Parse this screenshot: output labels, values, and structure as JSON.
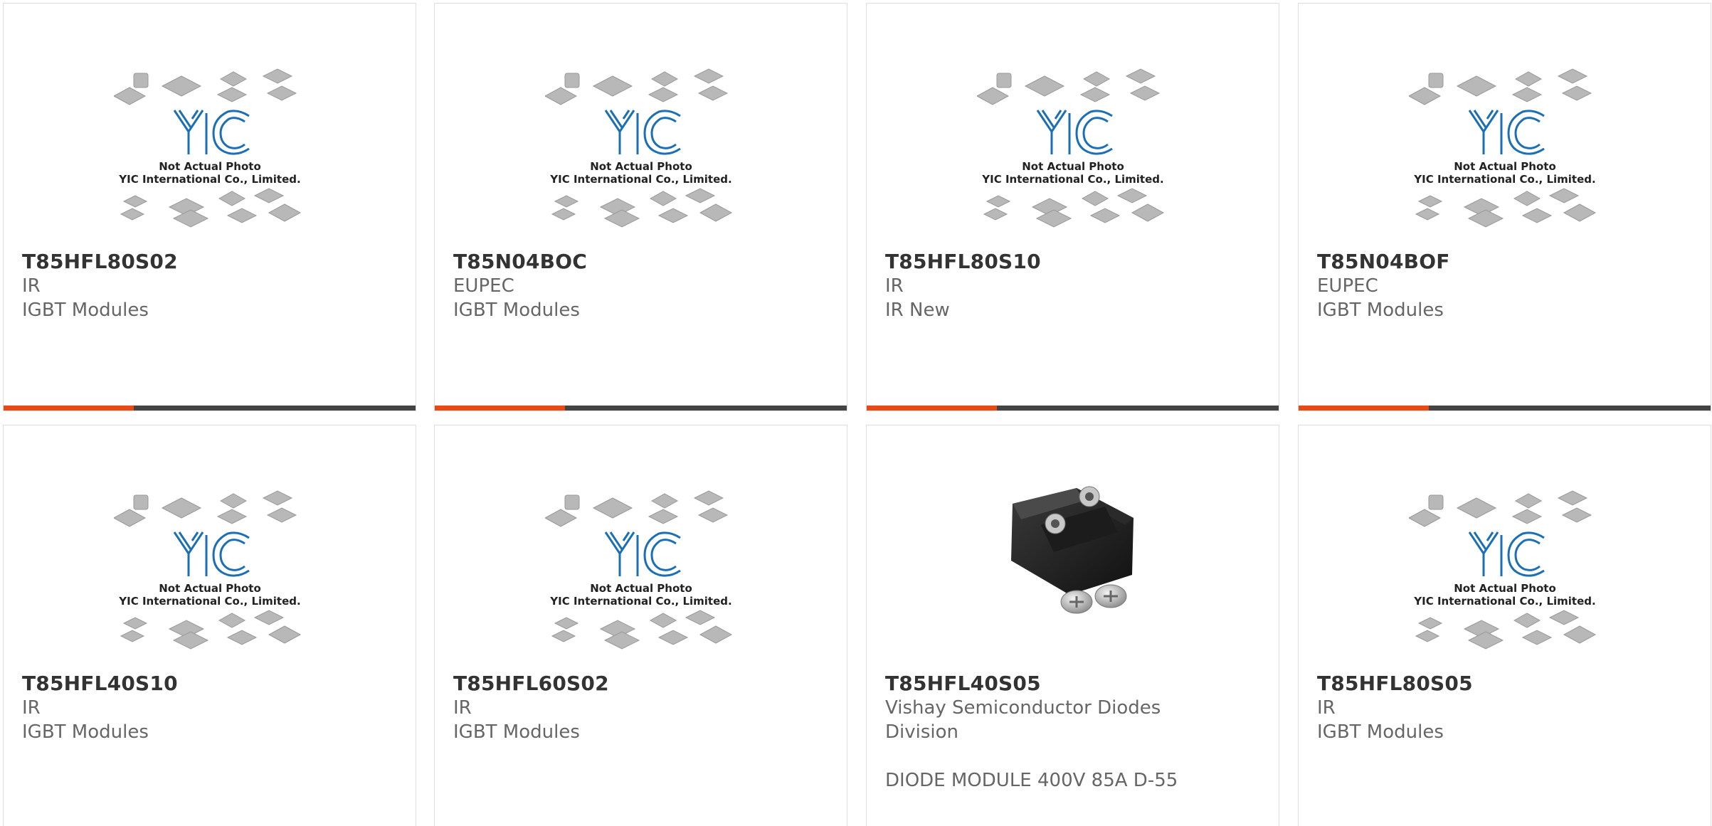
{
  "accent_color": "#e84a16",
  "bar_color": "#444444",
  "placeholder_image": {
    "line1": "Not Actual Photo",
    "line2": "YIC International Co., Limited."
  },
  "products": [
    {
      "part": "T85HFL80S02",
      "manufacturer": "IR",
      "description": "IGBT Modules",
      "image": "placeholder"
    },
    {
      "part": "T85N04BOC",
      "manufacturer": "EUPEC",
      "description": "IGBT Modules",
      "image": "placeholder"
    },
    {
      "part": "T85HFL80S10",
      "manufacturer": "IR",
      "description": "IR New",
      "image": "placeholder"
    },
    {
      "part": "T85N04BOF",
      "manufacturer": "EUPEC",
      "description": "IGBT Modules",
      "image": "placeholder"
    },
    {
      "part": "T85HFL40S10",
      "manufacturer": "IR",
      "description": "IGBT Modules",
      "image": "placeholder"
    },
    {
      "part": "T85HFL60S02",
      "manufacturer": "IR",
      "description": "IGBT Modules",
      "image": "placeholder"
    },
    {
      "part": "T85HFL40S05",
      "manufacturer": "Vishay Semiconductor Diodes Division",
      "description": "DIODE MODULE 400V 85A D-55",
      "image": "diode-module"
    },
    {
      "part": "T85HFL80S05",
      "manufacturer": "IR",
      "description": "IGBT Modules",
      "image": "placeholder"
    }
  ]
}
